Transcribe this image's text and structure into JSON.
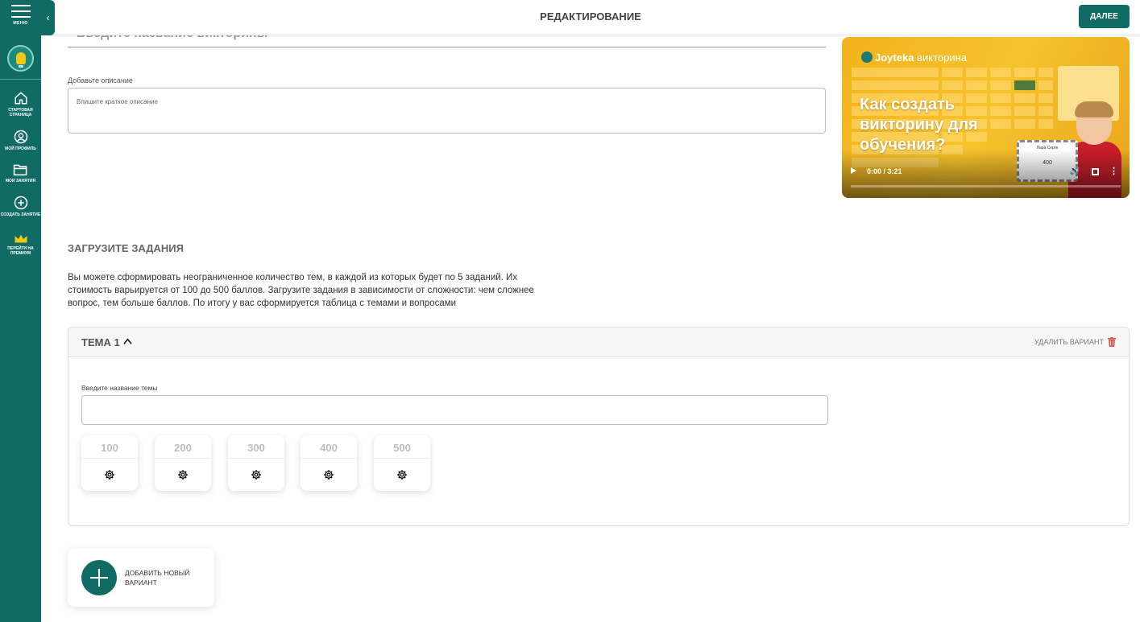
{
  "sidebar": {
    "menu_label": "МЕНЮ",
    "items": [
      {
        "label": "СТАРТОВАЯ СТРАНИЦА",
        "icon": "home-icon"
      },
      {
        "label": "МОЙ ПРОФИЛЬ",
        "icon": "profile-icon"
      },
      {
        "label": "МОИ ЗАНЯТИЯ",
        "icon": "folder-icon"
      },
      {
        "label": "СОЗДАТЬ ЗАНЯТИЕ",
        "icon": "plus-circle-icon"
      },
      {
        "label": "ПЕРЕЙТИ НА ПРЕМИУМ",
        "icon": "crown-icon"
      }
    ]
  },
  "header": {
    "title": "РЕДАКТИРОВАНИЕ",
    "next_button": "ДАЛЕЕ"
  },
  "form": {
    "title_placeholder": "Введите название викторины",
    "description_label": "Добавьте описание",
    "description_placeholder": "Впишите краткое описание"
  },
  "video": {
    "brand": "Joyteka",
    "brand_sub": "викторина",
    "headline": "Как создать викторину для обучения?",
    "card_title": "Лара Серге",
    "card_value": "400",
    "time": "0:00 / 3:21",
    "progress": 0
  },
  "tasks": {
    "title": "ЗАГРУЗИТЕ ЗАДАНИЯ",
    "description": "Вы можете сформировать неограниченное количество тем, в каждой из которых будет по 5 заданий. Их стоимость варьируется от 100 до 500 баллов. Загрузите задания в зависимости от сложности: чем сложнее вопрос, тем больше баллов. По итогу у вас сформируется таблица с темами и вопросами"
  },
  "theme": {
    "name": "ТЕМА 1",
    "delete_label": "УДАЛИТЬ ВАРИАНТ",
    "topic_label": "Введите название темы",
    "topic_value": "",
    "scores": [
      "100",
      "200",
      "300",
      "400",
      "500"
    ]
  },
  "add_variant": {
    "label": "ДОБАВИТЬ НОВЫЙ ВАРИАНТ"
  },
  "colors": {
    "primary": "#0f6b63",
    "delete": "#d9534f",
    "video_bg": "#f3b31c"
  }
}
